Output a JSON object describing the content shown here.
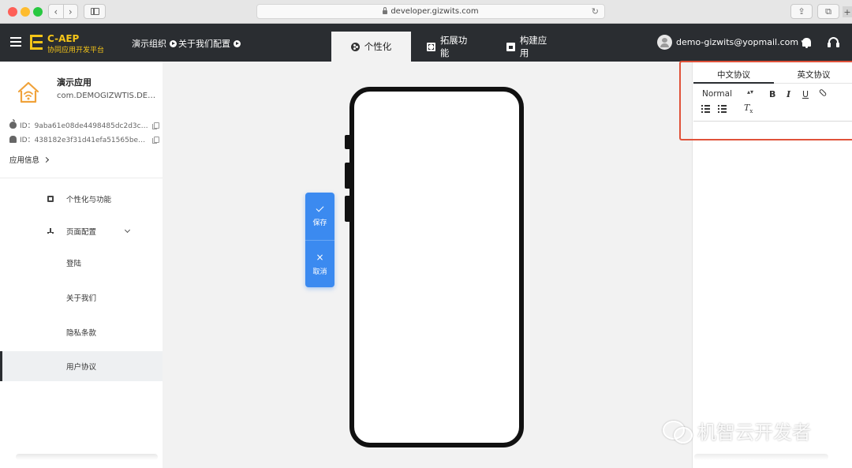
{
  "browser": {
    "url": "developer.gizwits.com",
    "nav_back": "‹",
    "nav_forward": "›",
    "reload": "↻",
    "share": "⇪",
    "tabs": "⧉",
    "plus": "+"
  },
  "header": {
    "brand_name": "C-AEP",
    "brand_sub": "协同应用开发平台",
    "org": "演示组织",
    "config": "关于我们配置",
    "tabs": [
      {
        "label": "个性化",
        "icon": "palette-icon",
        "active": true
      },
      {
        "label": "拓展功能",
        "icon": "expand-icon",
        "active": false
      },
      {
        "label": "构建应用",
        "icon": "build-icon",
        "active": false
      }
    ],
    "user_email": "demo-gizwits@yopmail.com ▾"
  },
  "sidebar": {
    "app_name": "演示应用",
    "bundle_id": "com.DEMOGIZWTIS.DEMO...",
    "ios_id": "ID：9aba61e08de4498485dc2d3ca...",
    "android_id": "ID：438182e3f31d41efa51565bed2...",
    "app_info": "应用信息",
    "items": [
      {
        "label": "个性化与功能",
        "icon": "grid-icon"
      },
      {
        "label": "页面配置",
        "icon": "tree-icon"
      },
      {
        "label": "登陆"
      },
      {
        "label": "关于我们"
      },
      {
        "label": "隐私条款"
      },
      {
        "label": "用户协议",
        "active": true
      }
    ]
  },
  "actions": {
    "save": "保存",
    "cancel": "取消",
    "cancel_glyph": "×"
  },
  "editor": {
    "tabs": [
      "中文协议",
      "英文协议"
    ],
    "format": "Normal",
    "format_caret": "▴▾",
    "bold": "B",
    "italic": "I",
    "underline": "U",
    "clear_format": "T",
    "clear_format_sub": "x"
  },
  "watermark": "机智云开发者",
  "colors": {
    "header_bg": "#2a2d31",
    "brand": "#f5c518",
    "action_blue": "#3b8af0",
    "highlight_border": "#e0523a"
  }
}
